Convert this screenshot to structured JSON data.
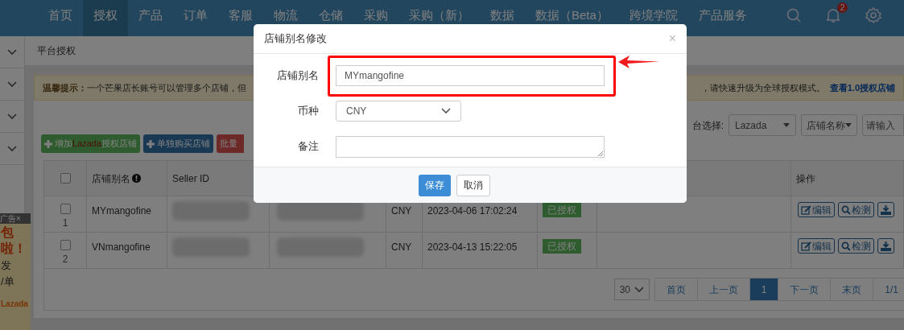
{
  "nav": {
    "items": [
      {
        "label": "首页",
        "selected": false
      },
      {
        "label": "授权",
        "selected": true
      },
      {
        "label": "产品",
        "selected": false
      },
      {
        "label": "订单",
        "selected": false
      },
      {
        "label": "客服",
        "selected": false
      },
      {
        "label": "物流",
        "selected": false
      },
      {
        "label": "仓储",
        "selected": false
      },
      {
        "label": "采购",
        "selected": false
      },
      {
        "label": "采购（新）",
        "selected": false
      },
      {
        "label": "数据",
        "selected": false
      },
      {
        "label": "数据（Beta）",
        "selected": false
      },
      {
        "label": "跨境学院",
        "selected": false
      },
      {
        "label": "产品服务",
        "selected": false
      }
    ],
    "notification_count": "2"
  },
  "ad": {
    "label": "广告",
    "close": "×",
    "lines": [
      "包",
      "啦！",
      "发",
      "/单",
      "Lazada"
    ]
  },
  "breadcrumb": "平台授权",
  "alert": {
    "title": "温馨提示：",
    "text_left": "一个芒果店长账号可以管理多个店铺，但",
    "text_right": "，请快速升级为全球授权模式。",
    "link": "查看1.0授权店铺"
  },
  "filters": {
    "label": "台选择:",
    "platform": "Lazada",
    "field": "店铺名称",
    "search_placeholder": "请输入"
  },
  "actions": [
    {
      "kind": "add",
      "label_before": "增加",
      "label_platform": "Lazada",
      "label_after": "授权店铺"
    },
    {
      "kind": "buy",
      "label": "单独购买店铺"
    },
    {
      "kind": "delete",
      "label": "批量"
    }
  ],
  "table": {
    "columns": [
      {
        "label": "店铺别名"
      },
      {
        "label": "Seller ID"
      },
      {
        "label": "操作"
      }
    ],
    "header_checked": false,
    "rows": [
      {
        "checked": false,
        "index": "1",
        "name": "MYmangofine",
        "currency": "CNY",
        "date": "2023-04-06 17:02:24",
        "status": "已授权",
        "ops": [
          {
            "kind": "edit",
            "label": "编辑"
          },
          {
            "kind": "check",
            "label": "检测"
          },
          {
            "kind": "more"
          }
        ]
      },
      {
        "checked": false,
        "index": "2",
        "name": "VNmangofine",
        "currency": "CNY",
        "date": "2023-04-13 15:22:05",
        "status": "已授权",
        "ops": [
          {
            "kind": "edit",
            "label": "编辑"
          },
          {
            "kind": "check",
            "label": "检测"
          },
          {
            "kind": "more"
          }
        ]
      }
    ]
  },
  "pagination": {
    "page_size": "30",
    "pages": [
      {
        "label": "首页",
        "selected": false
      },
      {
        "label": "上一页",
        "selected": false
      },
      {
        "label": "1",
        "selected": true
      },
      {
        "label": "下一页",
        "selected": false
      },
      {
        "label": "末页",
        "selected": false
      },
      {
        "label": "1/1",
        "selected": false
      }
    ]
  },
  "dialog": {
    "title": "店铺别名修改",
    "close": "×",
    "fields": [
      {
        "kind": "input",
        "label": "店铺别名",
        "value": "MYmangofine",
        "highlighted": true
      },
      {
        "kind": "select",
        "label": "币种",
        "value": "CNY"
      },
      {
        "kind": "textarea",
        "label": "备注"
      }
    ],
    "buttons": [
      {
        "kind": "primary",
        "label": "保存"
      },
      {
        "kind": "default",
        "label": "取消"
      }
    ]
  }
}
